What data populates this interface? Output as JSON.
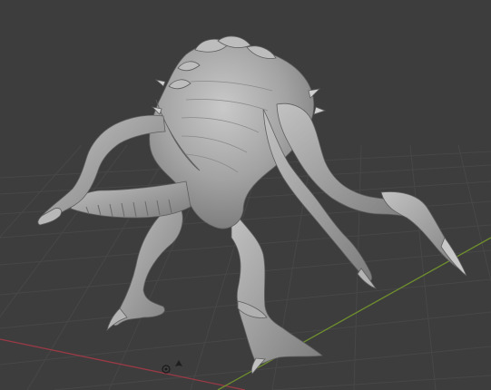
{
  "viewport": {
    "background": "#3d3d3d",
    "grid_color": "#4a4a4a",
    "x_axis_color": "#9a3a46",
    "y_axis_color": "#6f8f2e",
    "mesh_color": "#a9a9a9",
    "mesh_shadow": "#6e6e6e",
    "mesh_highlight": "#cfcfcf",
    "origin_icon": "object-origin-icon",
    "cursor_icon": "3d-cursor-icon"
  }
}
